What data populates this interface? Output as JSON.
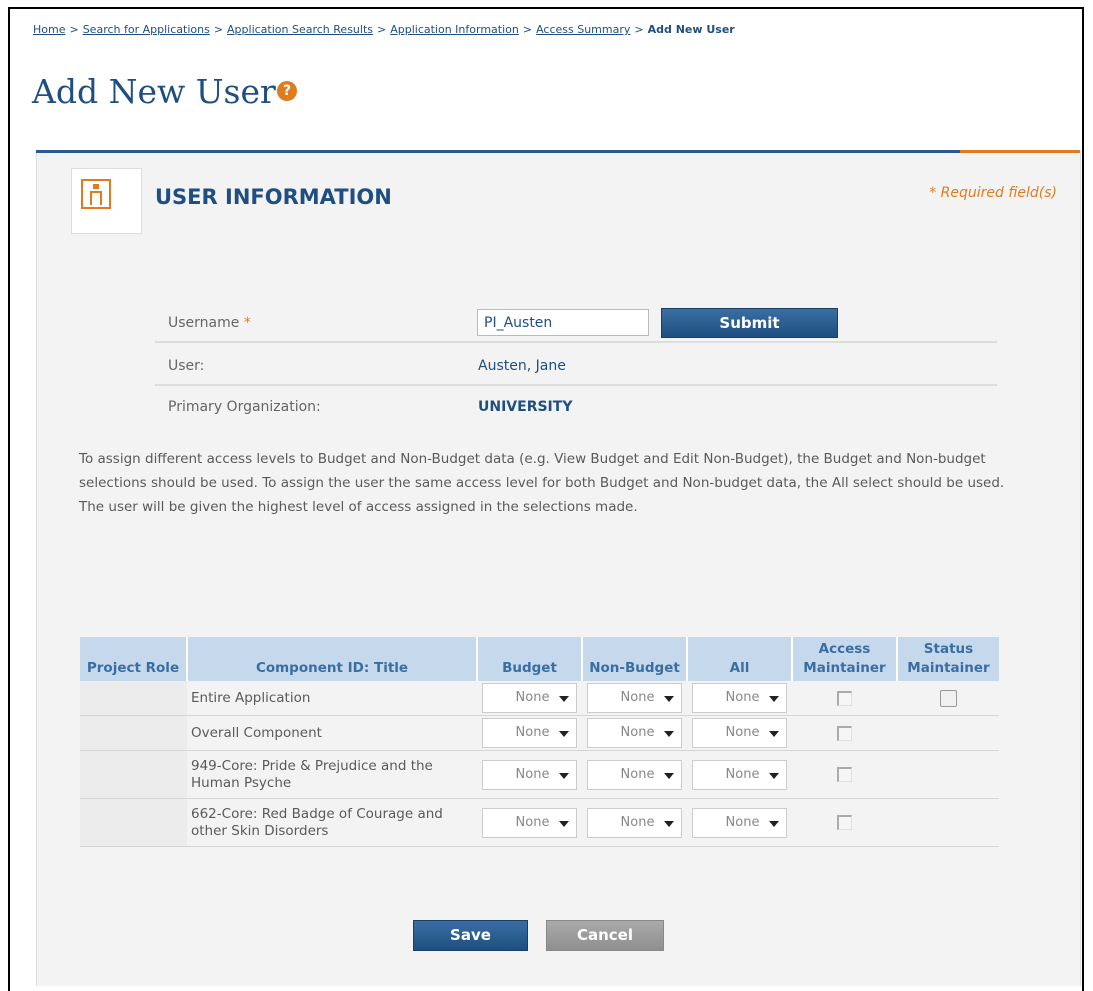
{
  "breadcrumb": {
    "items": [
      "Home",
      "Search for Applications",
      "Application Search Results",
      "Application Information",
      "Access Summary"
    ],
    "current": "Add New User",
    "separator": ">"
  },
  "page": {
    "title": "Add New User",
    "help_icon_label": "?"
  },
  "section": {
    "title": "USER INFORMATION",
    "required_note": "* Required field(s)"
  },
  "form": {
    "username_label": "Username",
    "username_required_mark": "*",
    "username_value": "PI_Austen",
    "submit_label": "Submit",
    "user_label": "User:",
    "user_value": "Austen, Jane",
    "org_label": "Primary Organization:",
    "org_value": "UNIVERSITY"
  },
  "instructions": "To assign different access levels to Budget and Non-Budget data (e.g. View Budget and Edit Non-Budget), the Budget and Non-budget selections should be used. To assign the user the same access level for both Budget and Non-budget data, the All select should be used. The user will be given the highest level of access assigned in the selections made.",
  "table": {
    "headers": {
      "role": "Project Role",
      "component": "Component ID: Title",
      "budget": "Budget",
      "non_budget": "Non-Budget",
      "all": "All",
      "access_maintainer": "Access Maintainer",
      "status_maintainer": "Status Maintainer"
    },
    "rows": [
      {
        "role": "",
        "component": "Entire Application",
        "budget": "None",
        "non_budget": "None",
        "all": "None"
      },
      {
        "role": "",
        "component": "Overall Component",
        "budget": "None",
        "non_budget": "None",
        "all": "None"
      },
      {
        "role": "",
        "component": "949-Core: Pride & Prejudice and the Human Psyche",
        "budget": "None",
        "non_budget": "None",
        "all": "None"
      },
      {
        "role": "",
        "component": "662-Core: Red Badge of Courage and other Skin Disorders",
        "budget": "None",
        "non_budget": "None",
        "all": "None"
      }
    ]
  },
  "actions": {
    "save_label": "Save",
    "cancel_label": "Cancel"
  },
  "colors": {
    "brand_blue": "#1f4f80",
    "accent_orange": "#e07c20",
    "header_blue": "#c6d9ec"
  }
}
